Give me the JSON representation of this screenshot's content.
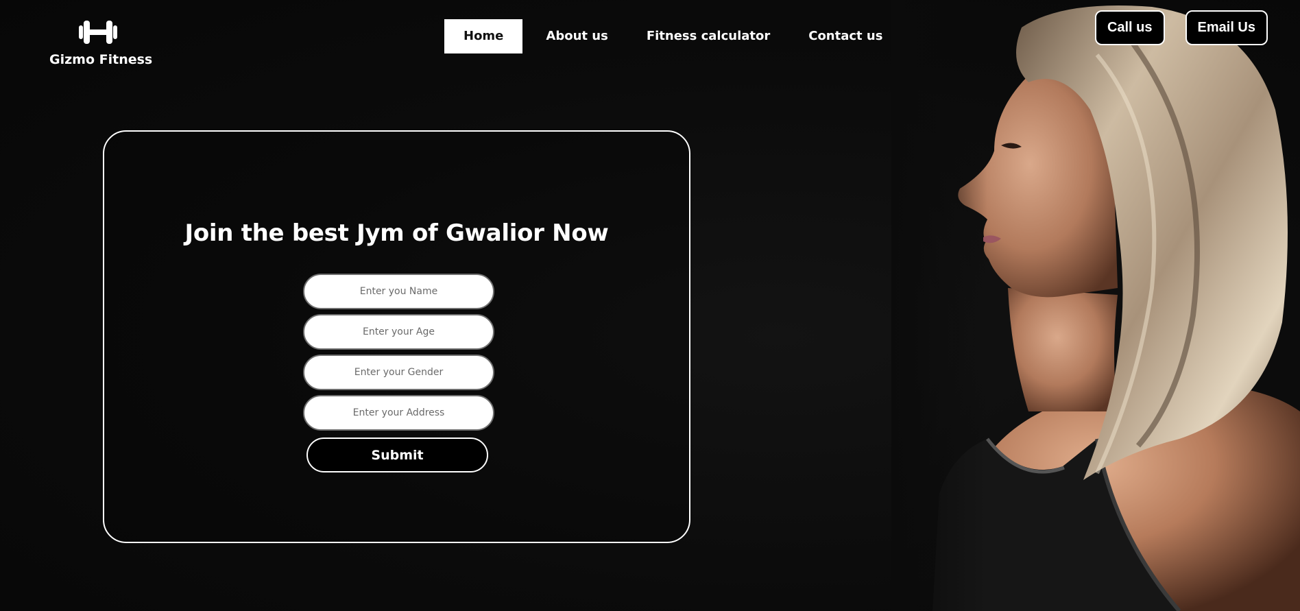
{
  "brand": {
    "icon": "dumbbell-icon",
    "name": "Gizmo Fitness"
  },
  "nav": {
    "items": [
      {
        "label": "Home",
        "active": true
      },
      {
        "label": "About us",
        "active": false
      },
      {
        "label": "Fitness calculator",
        "active": false
      },
      {
        "label": "Contact us",
        "active": false
      }
    ]
  },
  "header_actions": {
    "call_label": "Call us",
    "email_label": "Email Us"
  },
  "form": {
    "title": "Join the best Jym of Gwalior Now",
    "fields": {
      "name_placeholder": "Enter you Name",
      "age_placeholder": "Enter your Age",
      "gender_placeholder": "Enter your Gender",
      "address_placeholder": "Enter your Address"
    },
    "submit_label": "Submit"
  },
  "colors": {
    "background": "#0a0a0a",
    "accent": "#ffffff",
    "text": "#ffffff"
  }
}
